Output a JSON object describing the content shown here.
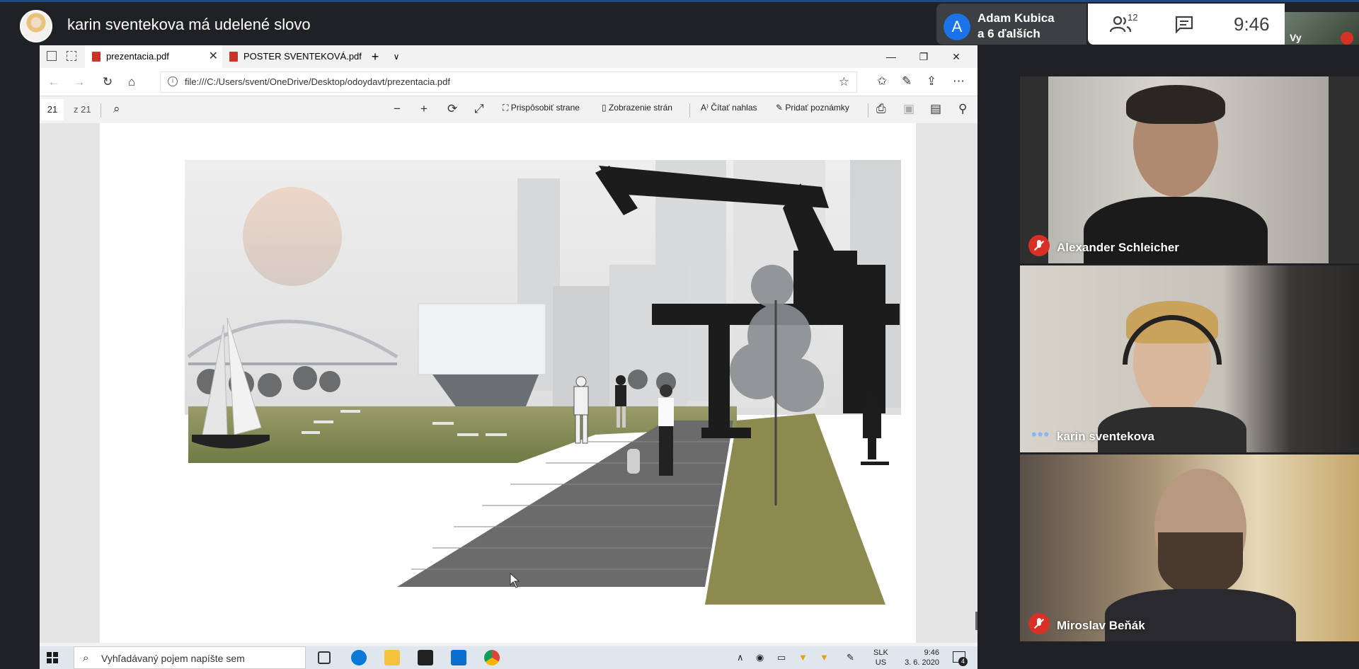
{
  "meet": {
    "presenter_title": "karin sventekova má udelené slovo",
    "participants_chip": {
      "avatar_letter": "A",
      "name": "Adam Kubica",
      "more": "a 6 ďalších"
    },
    "people_count": "12",
    "time": "9:46",
    "self_label": "Vy"
  },
  "browser": {
    "tabs": [
      {
        "label": "prezentacia.pdf",
        "active": true
      },
      {
        "label": "POSTER SVENTEKOVÁ.pdf",
        "active": false
      }
    ],
    "url": "file:///C:/Users/svent/OneDrive/Desktop/odoydavt/prezentacia.pdf"
  },
  "pdf_toolbar": {
    "page": "21",
    "of_pages": "z 21",
    "fit_page": "Prispôsobiť strane",
    "page_view": "Zobrazenie strán",
    "read_aloud": "Čítať nahlas",
    "add_notes": "Pridať poznámky"
  },
  "taskbar": {
    "search_placeholder": "Vyhľadávaný pojem napíšte sem",
    "lang_line1": "SLK",
    "lang_line2": "US",
    "clock_time": "9:46",
    "clock_date": "3. 6. 2020",
    "notifications": "4"
  },
  "participants": [
    {
      "name": "Alexander Schleicher",
      "muted": true
    },
    {
      "name": "karin sventekova",
      "muted": false,
      "speaking": true
    },
    {
      "name": "Miroslav Beňák",
      "muted": true
    }
  ],
  "colors": {
    "meet_bg": "#202124",
    "accent": "#1a73e8",
    "mute_red": "#d93025"
  }
}
